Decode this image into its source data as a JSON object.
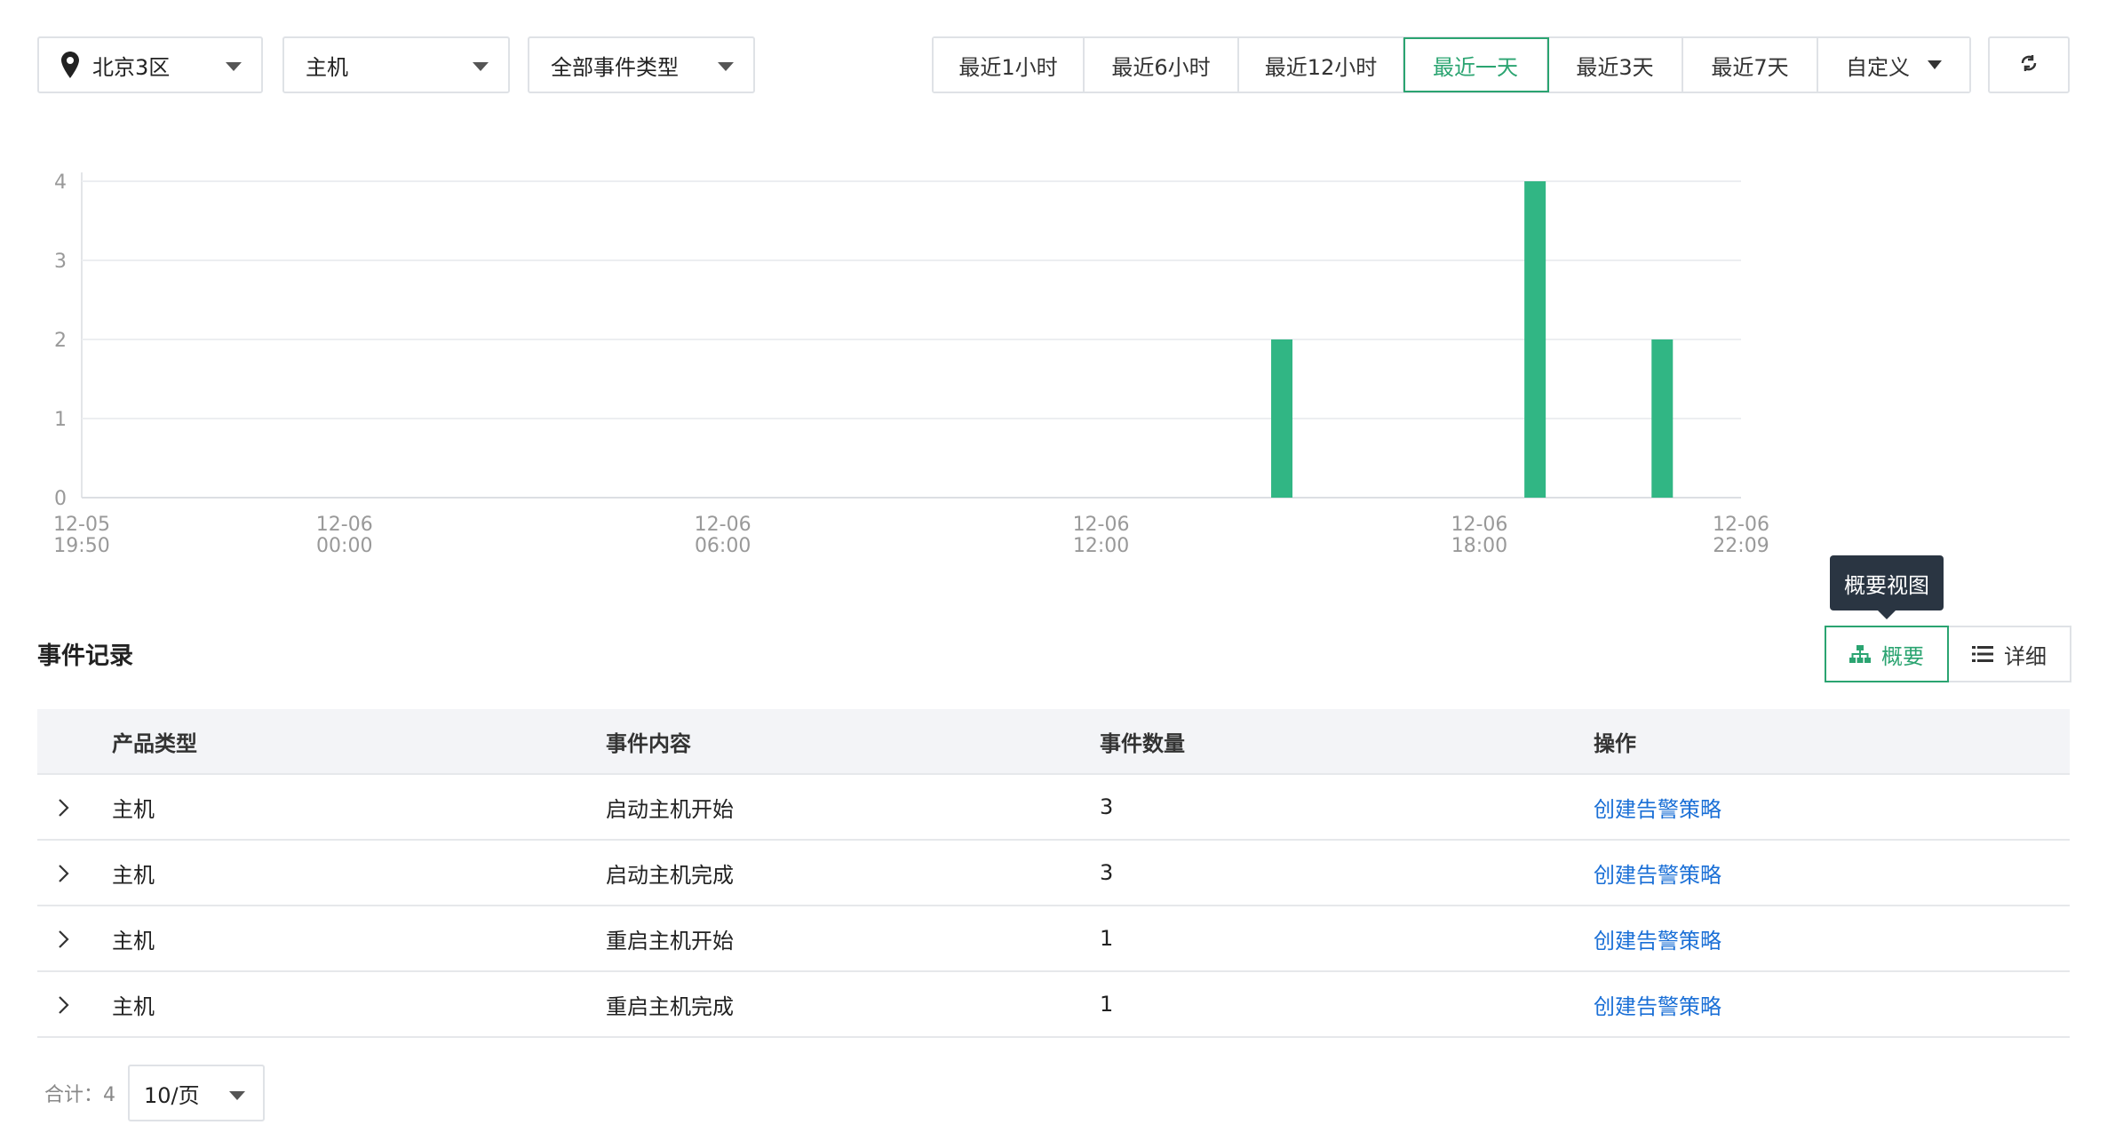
{
  "filters": {
    "region": "北京3区",
    "product": "主机",
    "event_type": "全部事件类型"
  },
  "time_ranges": [
    "最近1小时",
    "最近6小时",
    "最近12小时",
    "最近一天",
    "最近3天",
    "最近7天",
    "自定义"
  ],
  "active_time_range": "最近一天",
  "chart_data": {
    "type": "bar",
    "y_ticks": [
      0,
      1,
      2,
      3,
      4
    ],
    "ylim": [
      0,
      4
    ],
    "x_ticks": [
      {
        "line1": "12-05",
        "line2": "19:50"
      },
      {
        "line1": "12-06",
        "line2": "00:00"
      },
      {
        "line1": "12-06",
        "line2": "06:00"
      },
      {
        "line1": "12-06",
        "line2": "12:00"
      },
      {
        "line1": "12-06",
        "line2": "18:00"
      },
      {
        "line1": "12-06",
        "line2": "22:09"
      }
    ],
    "x_start": "12-05 19:50",
    "x_end": "12-06 22:09",
    "bars": [
      {
        "time": "12-06 14:52",
        "value": 2
      },
      {
        "time": "12-06 18:53",
        "value": 4
      },
      {
        "time": "12-06 20:54",
        "value": 2
      }
    ],
    "color": "#31b684",
    "grid": true
  },
  "section_title": "事件记录",
  "tooltip": "概要视图",
  "view_toggle": {
    "summary": "概要",
    "detail": "详细"
  },
  "table": {
    "headers": [
      "产品类型",
      "事件内容",
      "事件数量",
      "操作"
    ],
    "rows": [
      {
        "product": "主机",
        "content": "启动主机开始",
        "count": "3",
        "action": "创建告警策略"
      },
      {
        "product": "主机",
        "content": "启动主机完成",
        "count": "3",
        "action": "创建告警策略"
      },
      {
        "product": "主机",
        "content": "重启主机开始",
        "count": "1",
        "action": "创建告警策略"
      },
      {
        "product": "主机",
        "content": "重启主机完成",
        "count": "1",
        "action": "创建告警策略"
      }
    ]
  },
  "footer": {
    "total": "合计：4",
    "page_size": "10/页"
  }
}
